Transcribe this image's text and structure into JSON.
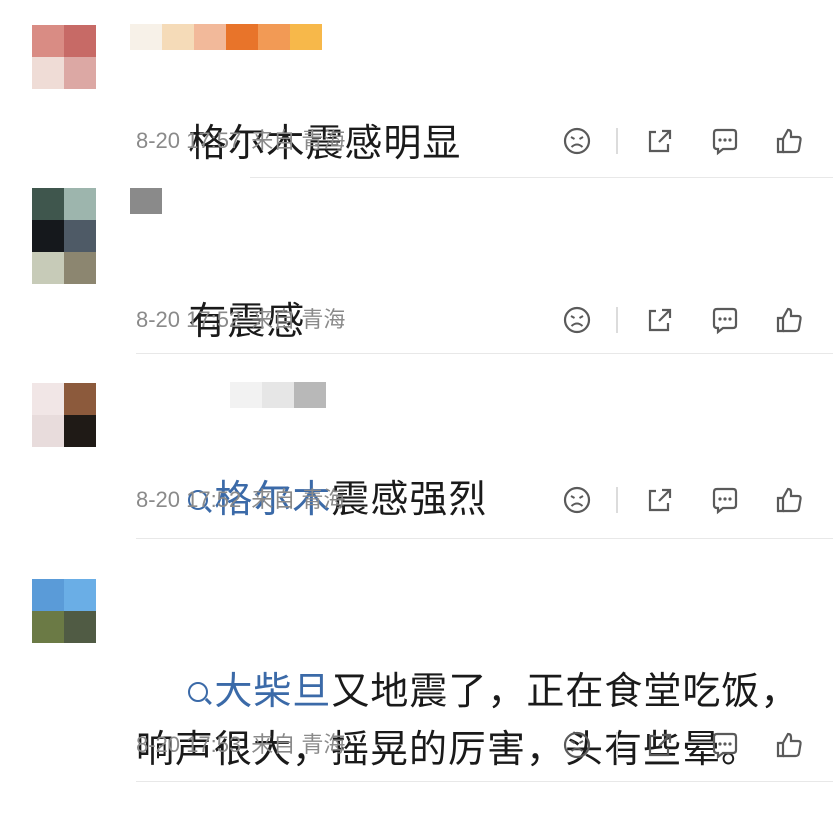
{
  "comments": [
    {
      "avatar": [
        "#d98c84",
        "#c76a66",
        "#efdcd6",
        "#dca8a4"
      ],
      "name_blocks": [
        "#f7f1e8",
        "#f5dbb8",
        "#f2b99a",
        "#e8742a",
        "#f29a55",
        "#f7b84a"
      ],
      "text": "格尔木震感明显",
      "topic": "",
      "time": "8-20 17:57",
      "from": "来自 青海"
    },
    {
      "avatar": [
        "#3f564d",
        "#9db5ad",
        "#15181c",
        "#4e5a66",
        "#c7cbb8",
        "#8c8670"
      ],
      "name_blocks": [
        "#8a8a8a"
      ],
      "text": "有震感",
      "topic": "",
      "time": "8-20 17:52",
      "from": "来自 青海"
    },
    {
      "avatar": [
        "#f1e6e6",
        "#8c5a3c",
        "#e8dcdc",
        "#1f1a16"
      ],
      "name_blocks": [
        "#f2f2f2",
        "#e6e6e6",
        "#b8b8b8"
      ],
      "text": "震感强烈",
      "topic": "格尔木",
      "time": "8-20 17:52",
      "from": "来自 青海"
    },
    {
      "avatar": [
        "#5a9bd8",
        "#6aaee6",
        "#6b7a45",
        "#505b44"
      ],
      "name_blocks": [],
      "text": "又地震了，正在食堂吃饭，\n响声很大，摇晃的厉害，头有些晕。",
      "topic": "大柴旦",
      "time": "8-20 17:53",
      "from": "来自 青海"
    }
  ],
  "icons": {
    "dislike": "frown-icon",
    "share": "share-icon",
    "comment": "comment-icon",
    "like": "thumbs-up-icon"
  },
  "colors": {
    "topic": "#3b6aa8",
    "meta": "#8a8a8a",
    "text": "#1a1a1a"
  }
}
